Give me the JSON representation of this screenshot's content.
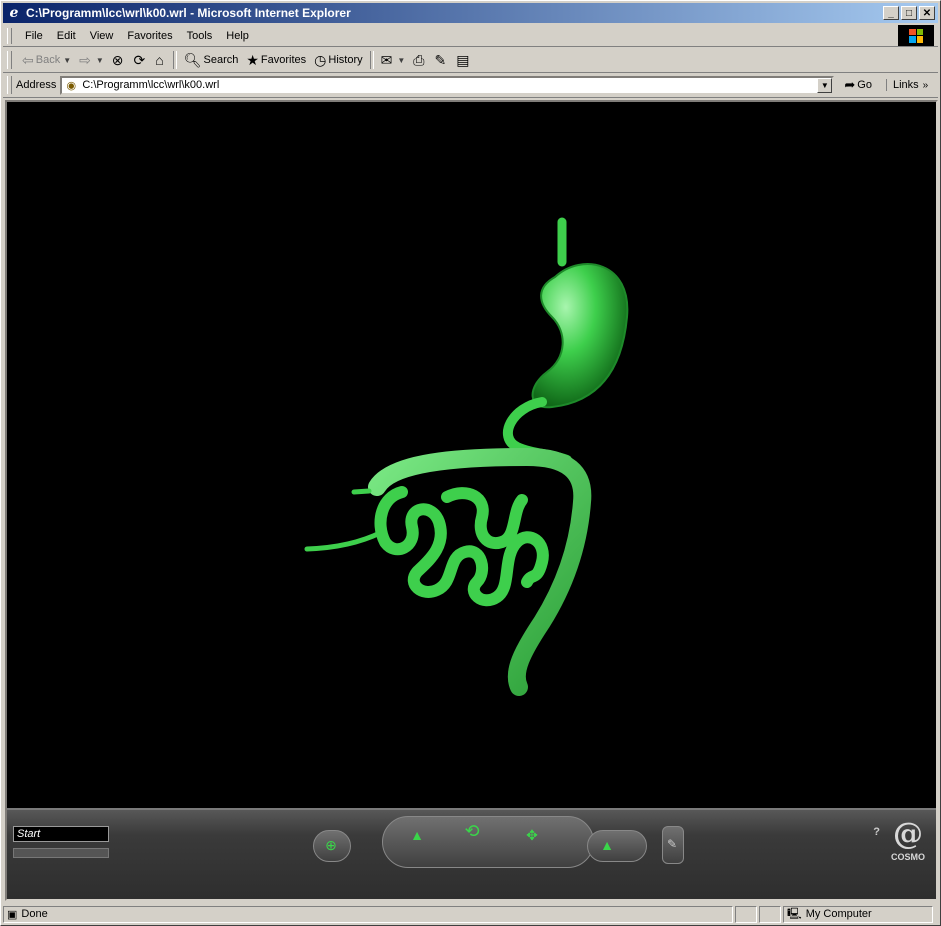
{
  "window": {
    "title": "C:\\Programm\\lcc\\wrl\\k00.wrl - Microsoft Internet Explorer"
  },
  "menu": {
    "items": [
      {
        "label": "File"
      },
      {
        "label": "Edit"
      },
      {
        "label": "View"
      },
      {
        "label": "Favorites"
      },
      {
        "label": "Tools"
      },
      {
        "label": "Help"
      }
    ]
  },
  "toolbar": {
    "back_label": "Back",
    "search_label": "Search",
    "favorites_label": "Favorites",
    "history_label": "History"
  },
  "address": {
    "label": "Address",
    "value": "C:\\Programm\\lcc\\wrl\\k00.wrl",
    "go_label": "Go",
    "links_label": "Links"
  },
  "vrml": {
    "background_color": "#000000",
    "model_color": "#3ecf4c"
  },
  "cosmo": {
    "viewpoint_label": "Start",
    "logo_text": "COSMO",
    "help_label": "?"
  },
  "status": {
    "text": "Done",
    "zone": "My Computer"
  }
}
